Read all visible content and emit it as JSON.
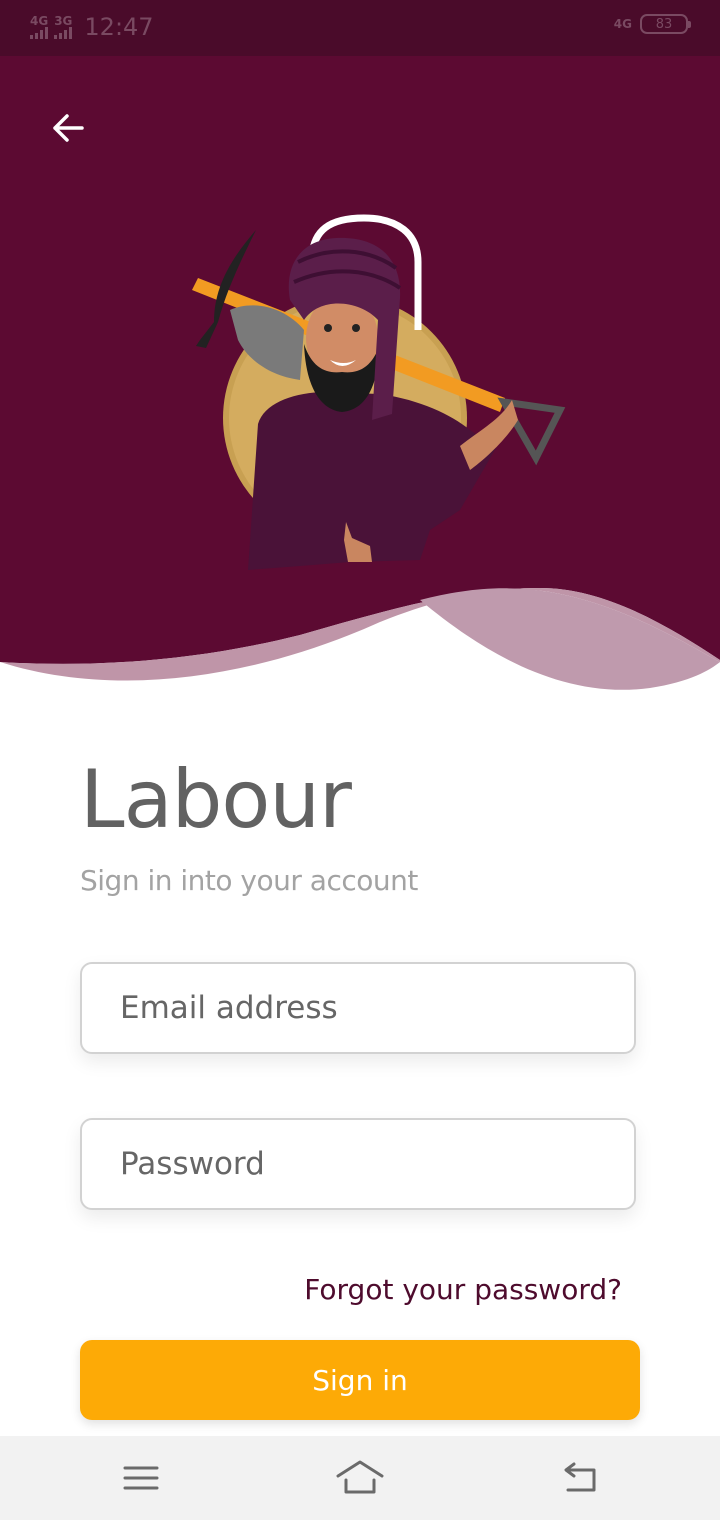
{
  "status_bar": {
    "network_1": "4G",
    "network_2": "3G",
    "time": "12:47",
    "network_right": "4G",
    "battery": "83"
  },
  "header": {
    "back_icon": "arrow-left-icon",
    "illustration": "labourer-with-pickaxe-illustration"
  },
  "login": {
    "title": "Labour",
    "subtitle": "Sign in into your account",
    "email_placeholder": "Email address",
    "password_placeholder": "Password",
    "forgot_label": "Forgot your password?",
    "signin_label": "Sign in"
  },
  "nav_bar": {
    "menu_icon": "menu-icon",
    "home_icon": "home-icon",
    "back_icon": "back-icon"
  },
  "colors": {
    "brand": "#5c0a32",
    "accent": "#fdaa06",
    "link": "#4e0b2d"
  }
}
